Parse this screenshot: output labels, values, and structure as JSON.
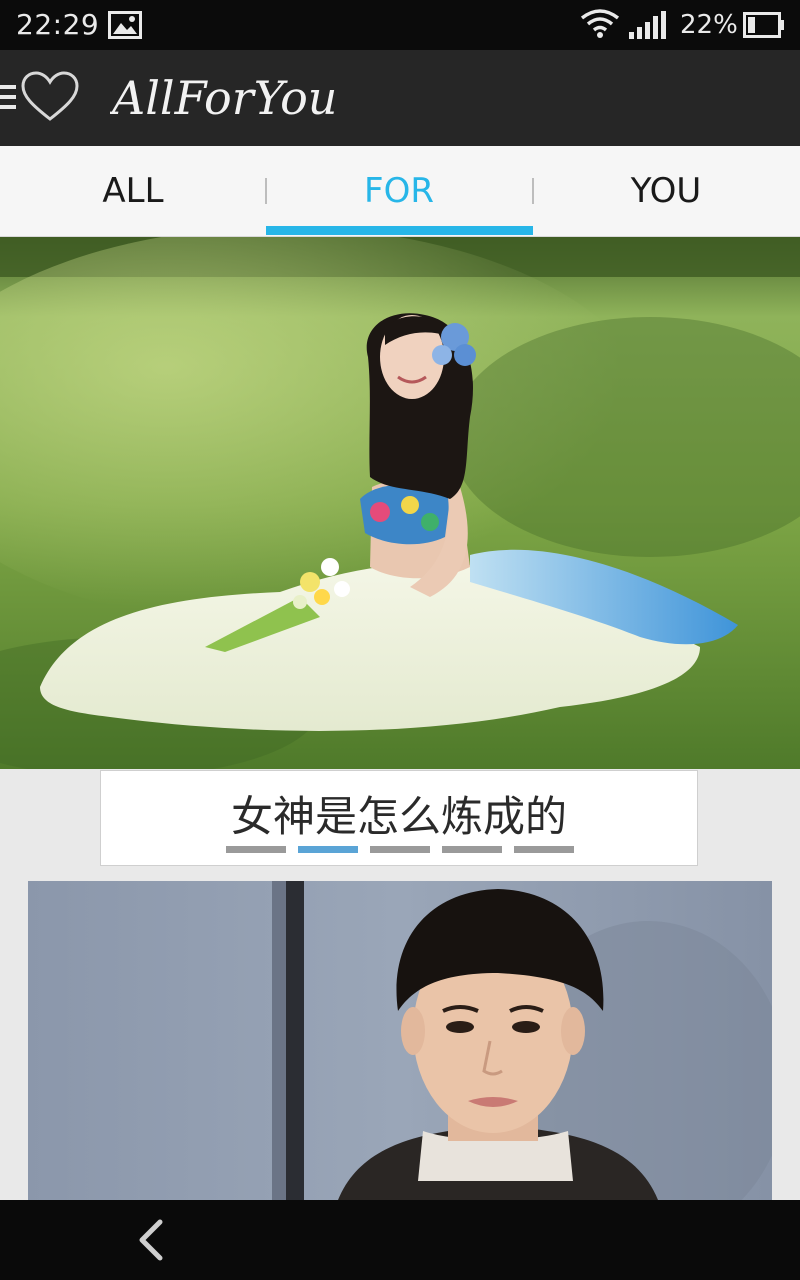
{
  "status": {
    "time": "22:29",
    "battery_text": "22%",
    "icons": [
      "gallery-icon",
      "wifi-icon",
      "signal-icon",
      "battery-icon"
    ]
  },
  "app": {
    "logo_text": "AllForYou"
  },
  "tabs": [
    {
      "label": "ALL"
    },
    {
      "label": "FOR"
    },
    {
      "label": "YOU"
    }
  ],
  "active_tab": 1,
  "carousel": {
    "caption": "女神是怎么炼成的",
    "count": 5,
    "active_index": 1
  },
  "colors": {
    "accent": "#27b6e8",
    "indicator_active": "#5aa4d6",
    "indicator_idle": "#9a9a9a",
    "appbar": "#262626",
    "statusbar": "#0b0b0b"
  }
}
